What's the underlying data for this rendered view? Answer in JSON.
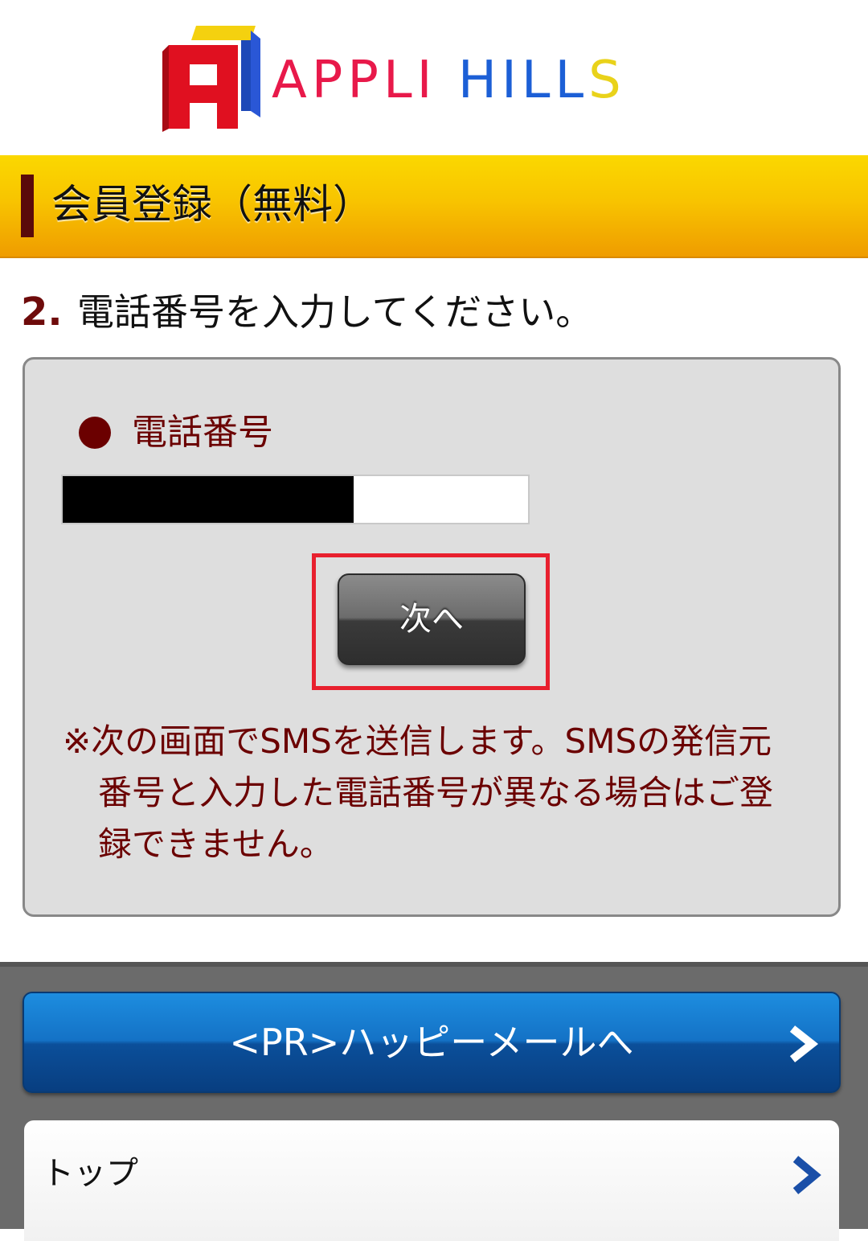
{
  "brand": {
    "logo_letter": "A",
    "word1": "APPLI",
    "word2": "HILL",
    "word3": "S",
    "colors": {
      "red": "#e8194a",
      "blue": "#1c5fd6",
      "yellow": "#e9d21a"
    }
  },
  "section": {
    "title": "会員登録（無料）"
  },
  "step": {
    "number": "2.",
    "instruction": "電話番号を入力してください。"
  },
  "form": {
    "phone_label": "電話番号",
    "phone_value": "",
    "next_label": "次へ",
    "note": "※次の画面でSMSを送信します。SMSの発信元番号と入力した電話番号が異なる場合はご登録できません。"
  },
  "nav": {
    "pr_label": "<PR>ハッピーメールへ",
    "top_label": "トップ"
  },
  "icons": {
    "pr_chevron": "chevron-right-icon",
    "top_chevron": "chevron-right-icon"
  }
}
